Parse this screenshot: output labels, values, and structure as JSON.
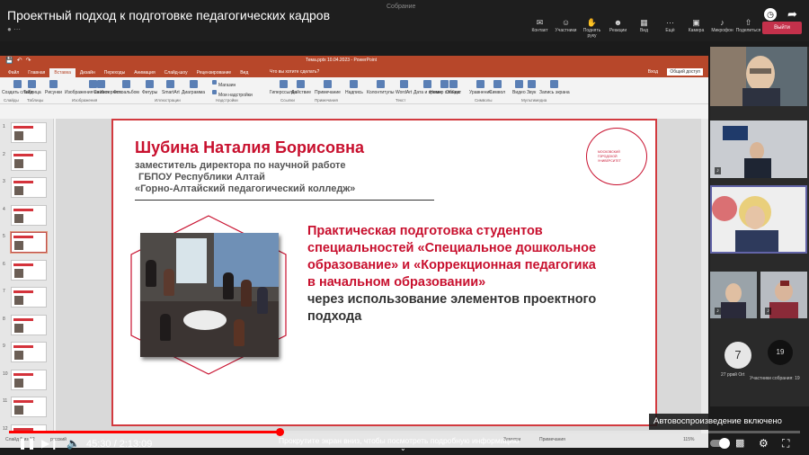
{
  "video": {
    "title": "Проектный подход к подготовке педагогических кадров",
    "current_time": "45:30",
    "duration": "2:13:09",
    "time_display": "45:30 / 2:13:09",
    "progress": 0.342,
    "scroll_hint": "Прокрутите экран вниз, чтобы посмотреть подробную информацию",
    "autoplay_tooltip": "Автовоспроизведение включено"
  },
  "meeting": {
    "title": "Собрание",
    "tools": [
      "Контакт",
      "Участники",
      "Поднять руку",
      "Реакции",
      "Вид",
      "Ещё"
    ],
    "tools2": [
      "Камера",
      "Микрофон",
      "Поделиться"
    ],
    "leave_label": "Выйти",
    "counters": [
      {
        "value": "7",
        "label": "27 ррвй Оrt"
      },
      {
        "value": "19",
        "label": "Участники собрания: 19"
      }
    ]
  },
  "powerpoint": {
    "document_title": "Тема.pptx 10.04.2023 - PowerPoint",
    "tabs": [
      "Файл",
      "Главная",
      "Вставка",
      "Дизайн",
      "Переходы",
      "Анимация",
      "Слайд-шоу",
      "Рецензирование",
      "Вид"
    ],
    "active_tab": "Вставка",
    "tell_me": "Что вы хотите сделать?",
    "login": "Вход",
    "share": "Общий доступ",
    "ribbon_items": [
      "Создать слайд",
      "Таблица",
      "Рисунки",
      "Изображения из Интернета",
      "Снимок",
      "Фотоальбом",
      "Фигуры",
      "SmartArt",
      "Диаграмма",
      "Магазин",
      "Мои надстройки",
      "Гиперссылка",
      "Действие",
      "Примечание",
      "Надпись",
      "Колонтитулы",
      "WordArt",
      "Дата и время",
      "Номер слайда",
      "Объект",
      "Уравнение",
      "Символ",
      "Видео",
      "Звук",
      "Запись экрана"
    ],
    "ribbon_groups": [
      "Слайды",
      "Таблицы",
      "Изображения",
      "Иллюстрации",
      "Надстройки",
      "Ссылки",
      "Примечания",
      "Текст",
      "Символы",
      "Мультимедиа"
    ],
    "status_left": "Слайд 5 из 12",
    "status_lang": "русский",
    "status_notes": "Заметки",
    "status_comments": "Примечания",
    "zoom": "115%",
    "thumbnail_numbers": [
      "1",
      "2",
      "3",
      "4",
      "5",
      "6",
      "7",
      "8",
      "9",
      "10",
      "11",
      "12"
    ],
    "selected_thumbnail": 5
  },
  "slide": {
    "speaker_name": "Шубина Наталия Борисовна",
    "speaker_lines": [
      "заместитель директора по научной работе",
      "ГБПОУ Республики Алтай",
      "«Горно-Алтайский педагогический колледж»"
    ],
    "logo_text": "МОСКОВСКИЙ ГОРОДСКОЙ УНИВЕРСИТЕТ",
    "talk_title_lines": [
      "Практическая подготовка студентов",
      "специальностей «Специальное дошкольное",
      "образование» и «Коррекционная педагогика",
      "в начальном образовании»"
    ],
    "talk_title_dark_lines": [
      "через  использование элементов проектного",
      "подхода"
    ]
  },
  "colors": {
    "accent": "#c8102e",
    "ppt_brand": "#b7472a",
    "youtube_red": "#ff0000",
    "teams_purple": "#6264a7"
  }
}
